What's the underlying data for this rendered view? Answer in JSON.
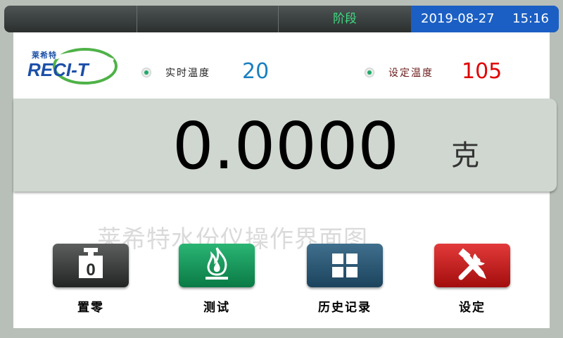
{
  "header": {
    "stage_label": "阶段",
    "date": "2019-08-27",
    "time": "15:16"
  },
  "logo": {
    "cn_text": "莱希特",
    "en_text": "RECI-T"
  },
  "temperature": {
    "realtime_label": "实时温度",
    "realtime_value": "20",
    "setpoint_label": "设定温度",
    "setpoint_value": "105"
  },
  "weight": {
    "value": "0.0000",
    "unit": "克"
  },
  "watermark": "莱希特水份仪操作界面图",
  "buttons": {
    "zero": {
      "label": "置零",
      "icon": "tare-weight-icon",
      "icon_text": "0",
      "color": "#333635"
    },
    "test": {
      "label": "测试",
      "icon": "flame-icon",
      "color": "#17a05e"
    },
    "history": {
      "label": "历史记录",
      "icon": "grid-icon",
      "color": "#2a5876"
    },
    "settings": {
      "label": "设定",
      "icon": "tools-icon",
      "color": "#c81f1f"
    }
  },
  "colors": {
    "stage_text": "#3ddc84",
    "datetime_bg": "#1b5fc4",
    "realtime_value": "#1a7fbf",
    "setpoint_value": "#e00000",
    "indicator": "#1faa66"
  }
}
